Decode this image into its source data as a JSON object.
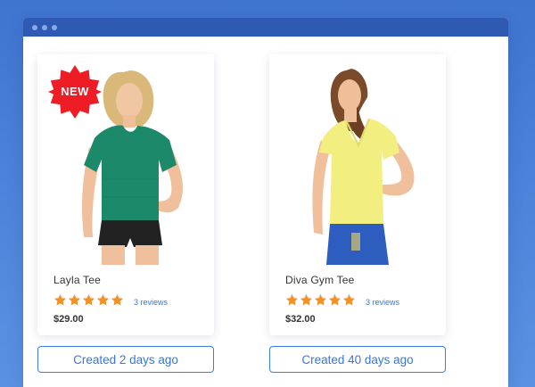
{
  "colors": {
    "background_top": "#3f74cf",
    "titlebar": "#2f5ab3",
    "accent": "#3777d8",
    "star": "#f4902a",
    "badge": "#ee1c24"
  },
  "products": [
    {
      "name": "Layla Tee",
      "rating": 5,
      "reviews": "3 reviews",
      "price": "$29.00",
      "badge": "NEW",
      "created": "Created 2 days ago",
      "shirt_color": "#1c8a6a",
      "icon": "product-photo"
    },
    {
      "name": "Diva Gym Tee",
      "rating": 5,
      "reviews": "3 reviews",
      "price": "$32.00",
      "created": "Created 40 days ago",
      "shirt_color": "#f2ee80",
      "icon": "product-photo"
    }
  ]
}
